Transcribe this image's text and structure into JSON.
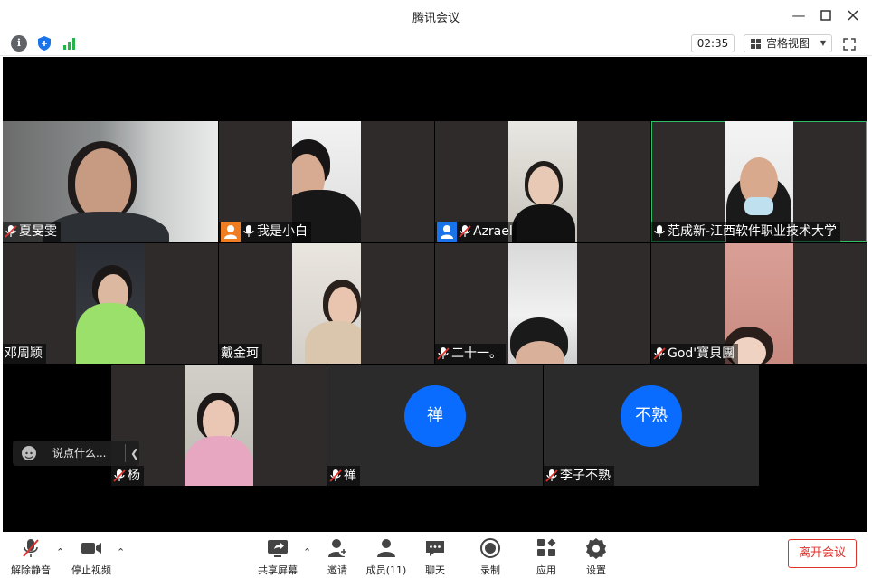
{
  "window": {
    "title": "腾讯会议"
  },
  "toolbar": {
    "timer": "02:35",
    "view_label": "宫格视图",
    "icons": [
      "info-icon",
      "shield-icon",
      "signal-icon",
      "fullscreen-icon"
    ]
  },
  "participants": [
    {
      "name": "夏旻雯",
      "mic": "muted"
    },
    {
      "name": "我是小白",
      "mic": "on",
      "badge": "avatar-orange"
    },
    {
      "name": "Azrael",
      "mic": "muted",
      "badge": "avatar-blue"
    },
    {
      "name": "范成新-江西软件职业技术大学",
      "mic": "on",
      "active": true
    },
    {
      "name": "邓周颖",
      "mic": "none"
    },
    {
      "name": "戴金珂",
      "mic": "none"
    },
    {
      "name": "二十一。",
      "mic": "muted"
    },
    {
      "name": "God'寶貝團",
      "mic": "muted"
    },
    {
      "name": "杨",
      "mic": "muted"
    },
    {
      "name": "禅",
      "mic": "muted",
      "avatar_text": "禅"
    },
    {
      "name": "李子不熟",
      "mic": "muted",
      "avatar_text": "不熟"
    }
  ],
  "chat": {
    "placeholder": "说点什么..."
  },
  "bottom": {
    "unmute": "解除静音",
    "stop_video": "停止视频",
    "share": "共享屏幕",
    "invite": "邀请",
    "members": "成员(11)",
    "chat": "聊天",
    "record": "录制",
    "apps": "应用",
    "settings": "设置",
    "leave": "离开会议"
  },
  "colors": {
    "accent": "#0a6cff",
    "leave": "#e0332e",
    "active_border": "#2fbf6b"
  }
}
